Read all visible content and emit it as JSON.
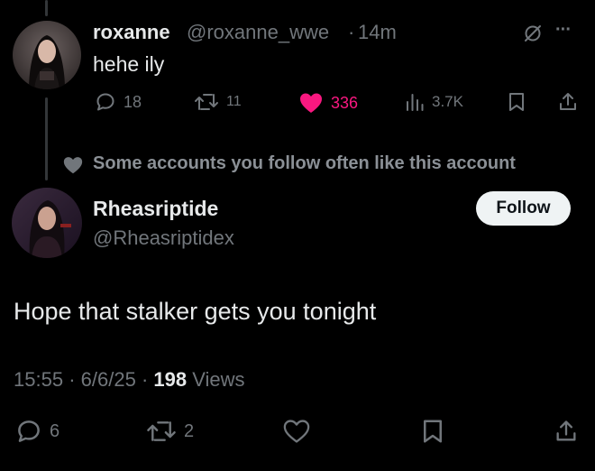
{
  "reply": {
    "author_name": "roxanne",
    "author_handle": "@roxanne_wwe",
    "separator": "·",
    "time_ago": "14m",
    "text": "hehe ily",
    "more_label": "···",
    "stats": {
      "replies": "18",
      "reposts": "11",
      "likes": "336",
      "views": "3.7K"
    },
    "icons": [
      "grok-icon",
      "more-icon",
      "reply-icon",
      "repost-icon",
      "like-icon",
      "views-icon",
      "bookmark-icon",
      "share-icon"
    ],
    "like_color": "#f91880"
  },
  "social_context": {
    "text": "Some accounts you follow often like this account",
    "icon": "heart-icon"
  },
  "main_tweet": {
    "author_name": "Rheasriptide",
    "author_handle": "@Rheasriptidex",
    "follow_label": "Follow",
    "text": "Hope that stalker gets you tonight",
    "time": "15:55",
    "separator": "·",
    "date": "6/6/25",
    "views_count": "198",
    "views_label": "Views",
    "stats": {
      "replies": "6",
      "reposts": "2"
    },
    "icons": [
      "reply-icon",
      "repost-icon",
      "like-icon",
      "bookmark-icon",
      "share-icon"
    ]
  },
  "colors": {
    "background": "#000000",
    "text_primary": "#e7e9ea",
    "text_secondary": "#71767b",
    "like_active": "#f91880",
    "follow_bg": "#eff3f4"
  }
}
